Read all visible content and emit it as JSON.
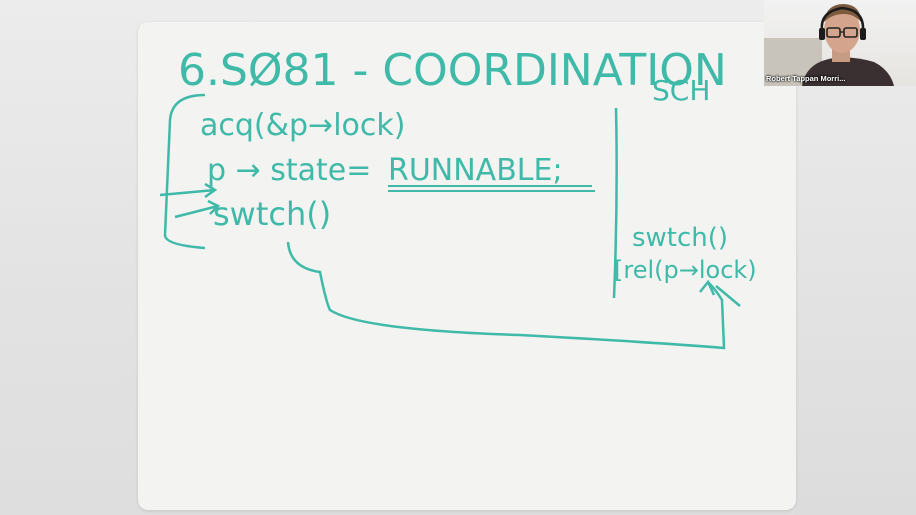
{
  "whiteboard": {
    "title": "6.SØ81 - COORDINATION",
    "subtitle": "SCH",
    "line_acquire": "acq(&p→lock)",
    "line_state_var": "p → state=",
    "line_state_value": "RUNNABLE;",
    "line_switch": "swtch()",
    "right_switch": "swtch()",
    "right_release": "[rel(p→lock)",
    "ink_color": "#3fb9a8"
  },
  "webcam": {
    "participant_name": "Robert Tappan Morri..."
  }
}
